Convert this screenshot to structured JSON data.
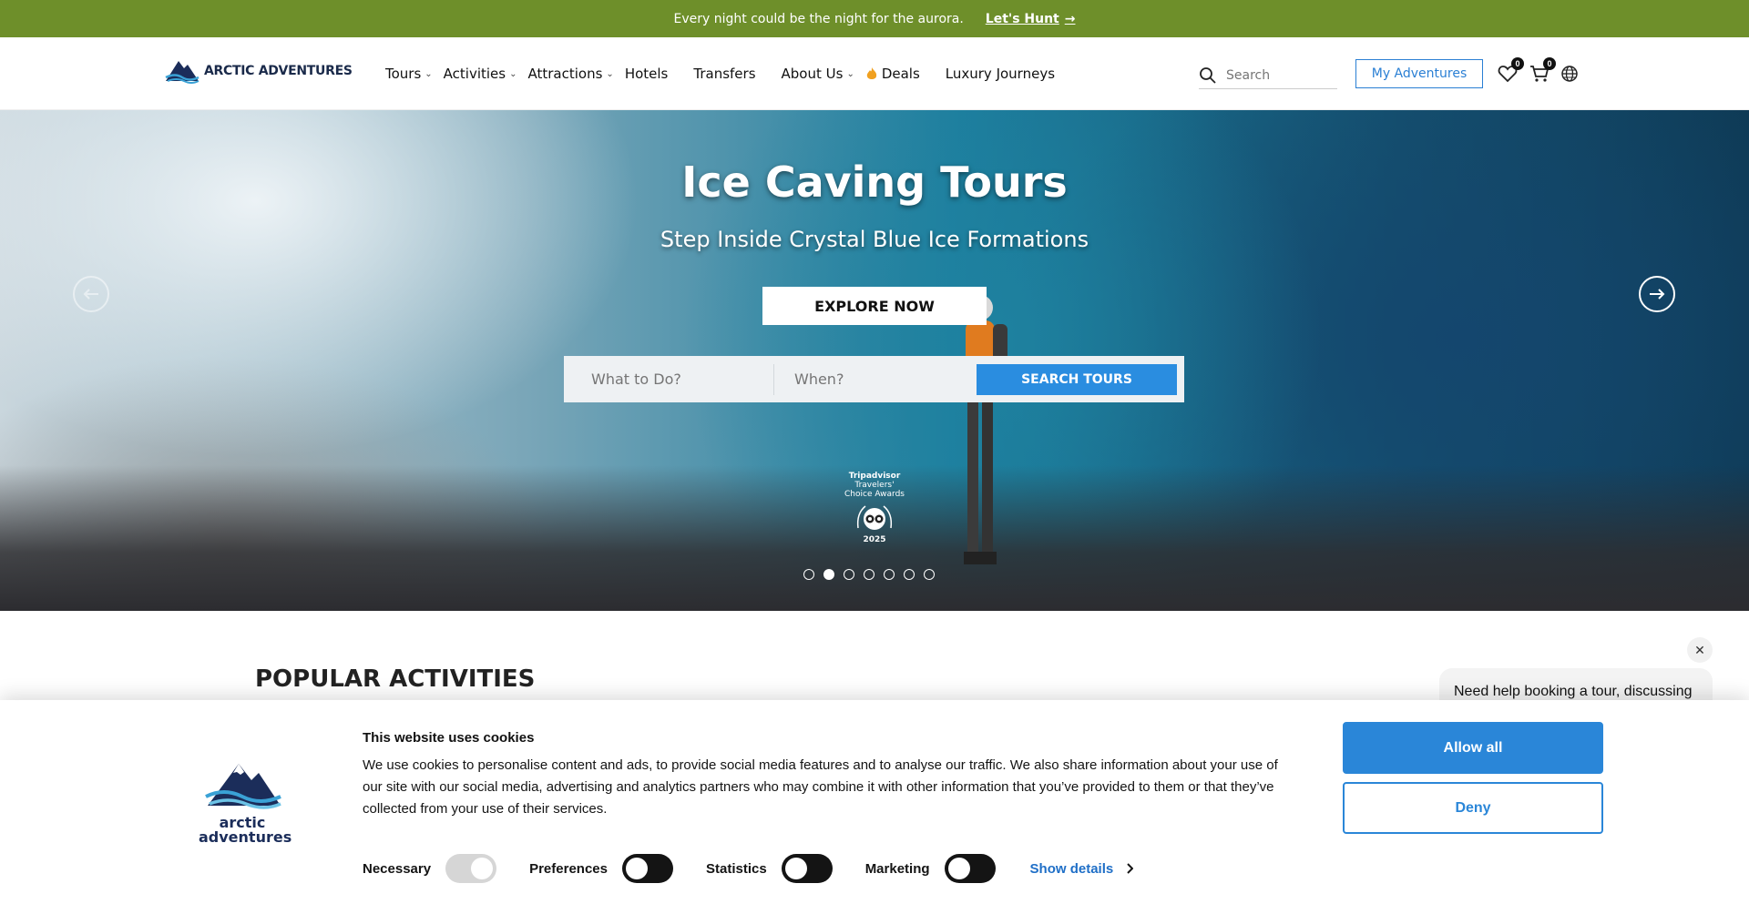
{
  "announcement": {
    "message": "Every night could be the night for the aurora.",
    "link_label": "Let's Hunt"
  },
  "header": {
    "logo_text": "ARCTIC ADVENTURES",
    "nav": [
      {
        "label": "Tours",
        "has_dropdown": true
      },
      {
        "label": "Activities",
        "has_dropdown": true
      },
      {
        "label": "Attractions",
        "has_dropdown": true
      },
      {
        "label": "Hotels",
        "has_dropdown": false
      },
      {
        "label": "Transfers",
        "has_dropdown": false
      },
      {
        "label": "About Us",
        "has_dropdown": true
      },
      {
        "label": "Deals",
        "has_dropdown": false,
        "icon": "flame-icon"
      },
      {
        "label": "Luxury Journeys",
        "has_dropdown": false
      }
    ],
    "search_placeholder": "Search",
    "my_adventures_label": "My Adventures",
    "wishlist_count": "0",
    "cart_count": "0"
  },
  "hero": {
    "title": "Ice Caving Tours",
    "subtitle": "Step Inside Crystal Blue Ice Formations",
    "cta_label": "EXPLORE NOW",
    "search": {
      "what_placeholder": "What to Do?",
      "when_placeholder": "When?",
      "button_label": "SEARCH TOURS"
    },
    "award_lines": [
      "Tripadvisor",
      "Travelers'",
      "Choice Awards",
      "2025"
    ],
    "slide_count": 7,
    "active_slide": 2
  },
  "section": {
    "title": "POPULAR ACTIVITIES"
  },
  "chat": {
    "message": "Need help booking a tour, discussing"
  },
  "cookie_banner": {
    "logo_words": [
      "arctic",
      "adventures"
    ],
    "title": "This website uses cookies",
    "body": "We use cookies to personalise content and ads, to provide social media features and to analyse our traffic. We also share information about your use of our site with our social media, advertising and analytics partners who may combine it with other information that you’ve provided to them or that they’ve collected from your use of their services.",
    "consents": [
      {
        "label": "Necessary",
        "enabled": true,
        "locked": true
      },
      {
        "label": "Preferences",
        "enabled": false,
        "locked": false
      },
      {
        "label": "Statistics",
        "enabled": false,
        "locked": false
      },
      {
        "label": "Marketing",
        "enabled": false,
        "locked": false
      }
    ],
    "show_details_label": "Show details",
    "allow_all_label": "Allow all",
    "deny_label": "Deny"
  },
  "colors": {
    "announcement_bg": "#6e8f2a",
    "accent_blue": "#2a86d8",
    "logo_navy": "#1b2d5a"
  }
}
